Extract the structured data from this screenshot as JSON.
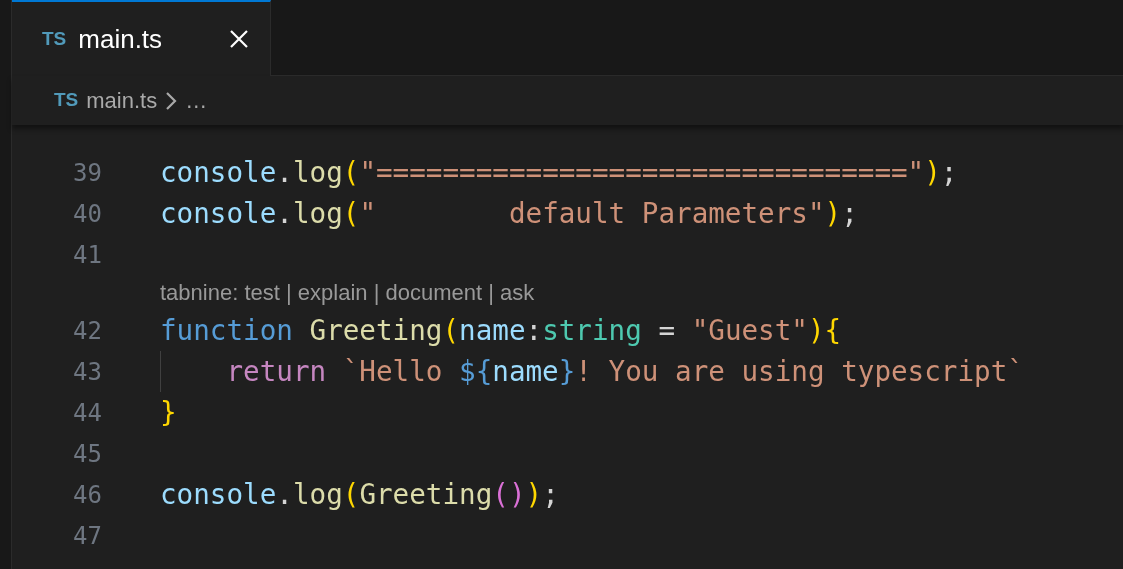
{
  "tabs": [
    {
      "icon_text": "TS",
      "label": "main.ts",
      "selected": true
    }
  ],
  "breadcrumb": {
    "icon_text": "TS",
    "file": "main.ts",
    "more": "…"
  },
  "editor": {
    "lines": [
      {
        "kind": "code",
        "number": "39",
        "tokens": [
          {
            "t": "console",
            "kind": "variable"
          },
          {
            "t": ".",
            "kind": "plain"
          },
          {
            "t": "log",
            "kind": "function"
          },
          {
            "t": "(",
            "kind": "bracket1"
          },
          {
            "t": "\"================================\"",
            "kind": "string"
          },
          {
            "t": ")",
            "kind": "bracket1"
          },
          {
            "t": ";",
            "kind": "plain"
          }
        ]
      },
      {
        "kind": "code",
        "number": "40",
        "tokens": [
          {
            "t": "console",
            "kind": "variable"
          },
          {
            "t": ".",
            "kind": "plain"
          },
          {
            "t": "log",
            "kind": "function"
          },
          {
            "t": "(",
            "kind": "bracket1"
          },
          {
            "t": "\"        default Parameters\"",
            "kind": "string"
          },
          {
            "t": ")",
            "kind": "bracket1"
          },
          {
            "t": ";",
            "kind": "plain"
          }
        ]
      },
      {
        "kind": "code",
        "number": "41"
      },
      {
        "kind": "codelens",
        "text": "tabnine: test | explain | document | ask"
      },
      {
        "kind": "code",
        "number": "42",
        "tokens": [
          {
            "t": "function ",
            "kind": "keyword"
          },
          {
            "t": "Greeting",
            "kind": "function"
          },
          {
            "t": "(",
            "kind": "bracket1"
          },
          {
            "t": "name",
            "kind": "variable"
          },
          {
            "t": ":",
            "kind": "plain"
          },
          {
            "t": "string",
            "kind": "type"
          },
          {
            "t": " = ",
            "kind": "plain"
          },
          {
            "t": "\"Guest\"",
            "kind": "string"
          },
          {
            "t": ")",
            "kind": "bracket1"
          },
          {
            "t": "{",
            "kind": "bracket1"
          }
        ]
      },
      {
        "kind": "code",
        "number": "43",
        "indent_guide": true,
        "tokens": [
          {
            "t": "    return ",
            "kind": "control"
          },
          {
            "t": "`Hello ",
            "kind": "string"
          },
          {
            "t": "${",
            "kind": "template"
          },
          {
            "t": "name",
            "kind": "variable"
          },
          {
            "t": "}",
            "kind": "template"
          },
          {
            "t": "! You are using typescript`",
            "kind": "string"
          }
        ]
      },
      {
        "kind": "code",
        "number": "44",
        "tokens": [
          {
            "t": "}",
            "kind": "bracket1"
          }
        ]
      },
      {
        "kind": "code",
        "number": "45"
      },
      {
        "kind": "code",
        "number": "46",
        "tokens": [
          {
            "t": "console",
            "kind": "variable"
          },
          {
            "t": ".",
            "kind": "plain"
          },
          {
            "t": "log",
            "kind": "function"
          },
          {
            "t": "(",
            "kind": "bracket1"
          },
          {
            "t": "Greeting",
            "kind": "function"
          },
          {
            "t": "(",
            "kind": "bracket2"
          },
          {
            "t": ")",
            "kind": "bracket2"
          },
          {
            "t": ")",
            "kind": "bracket1"
          },
          {
            "t": ";",
            "kind": "plain"
          }
        ]
      },
      {
        "kind": "code",
        "number": "47"
      }
    ]
  }
}
